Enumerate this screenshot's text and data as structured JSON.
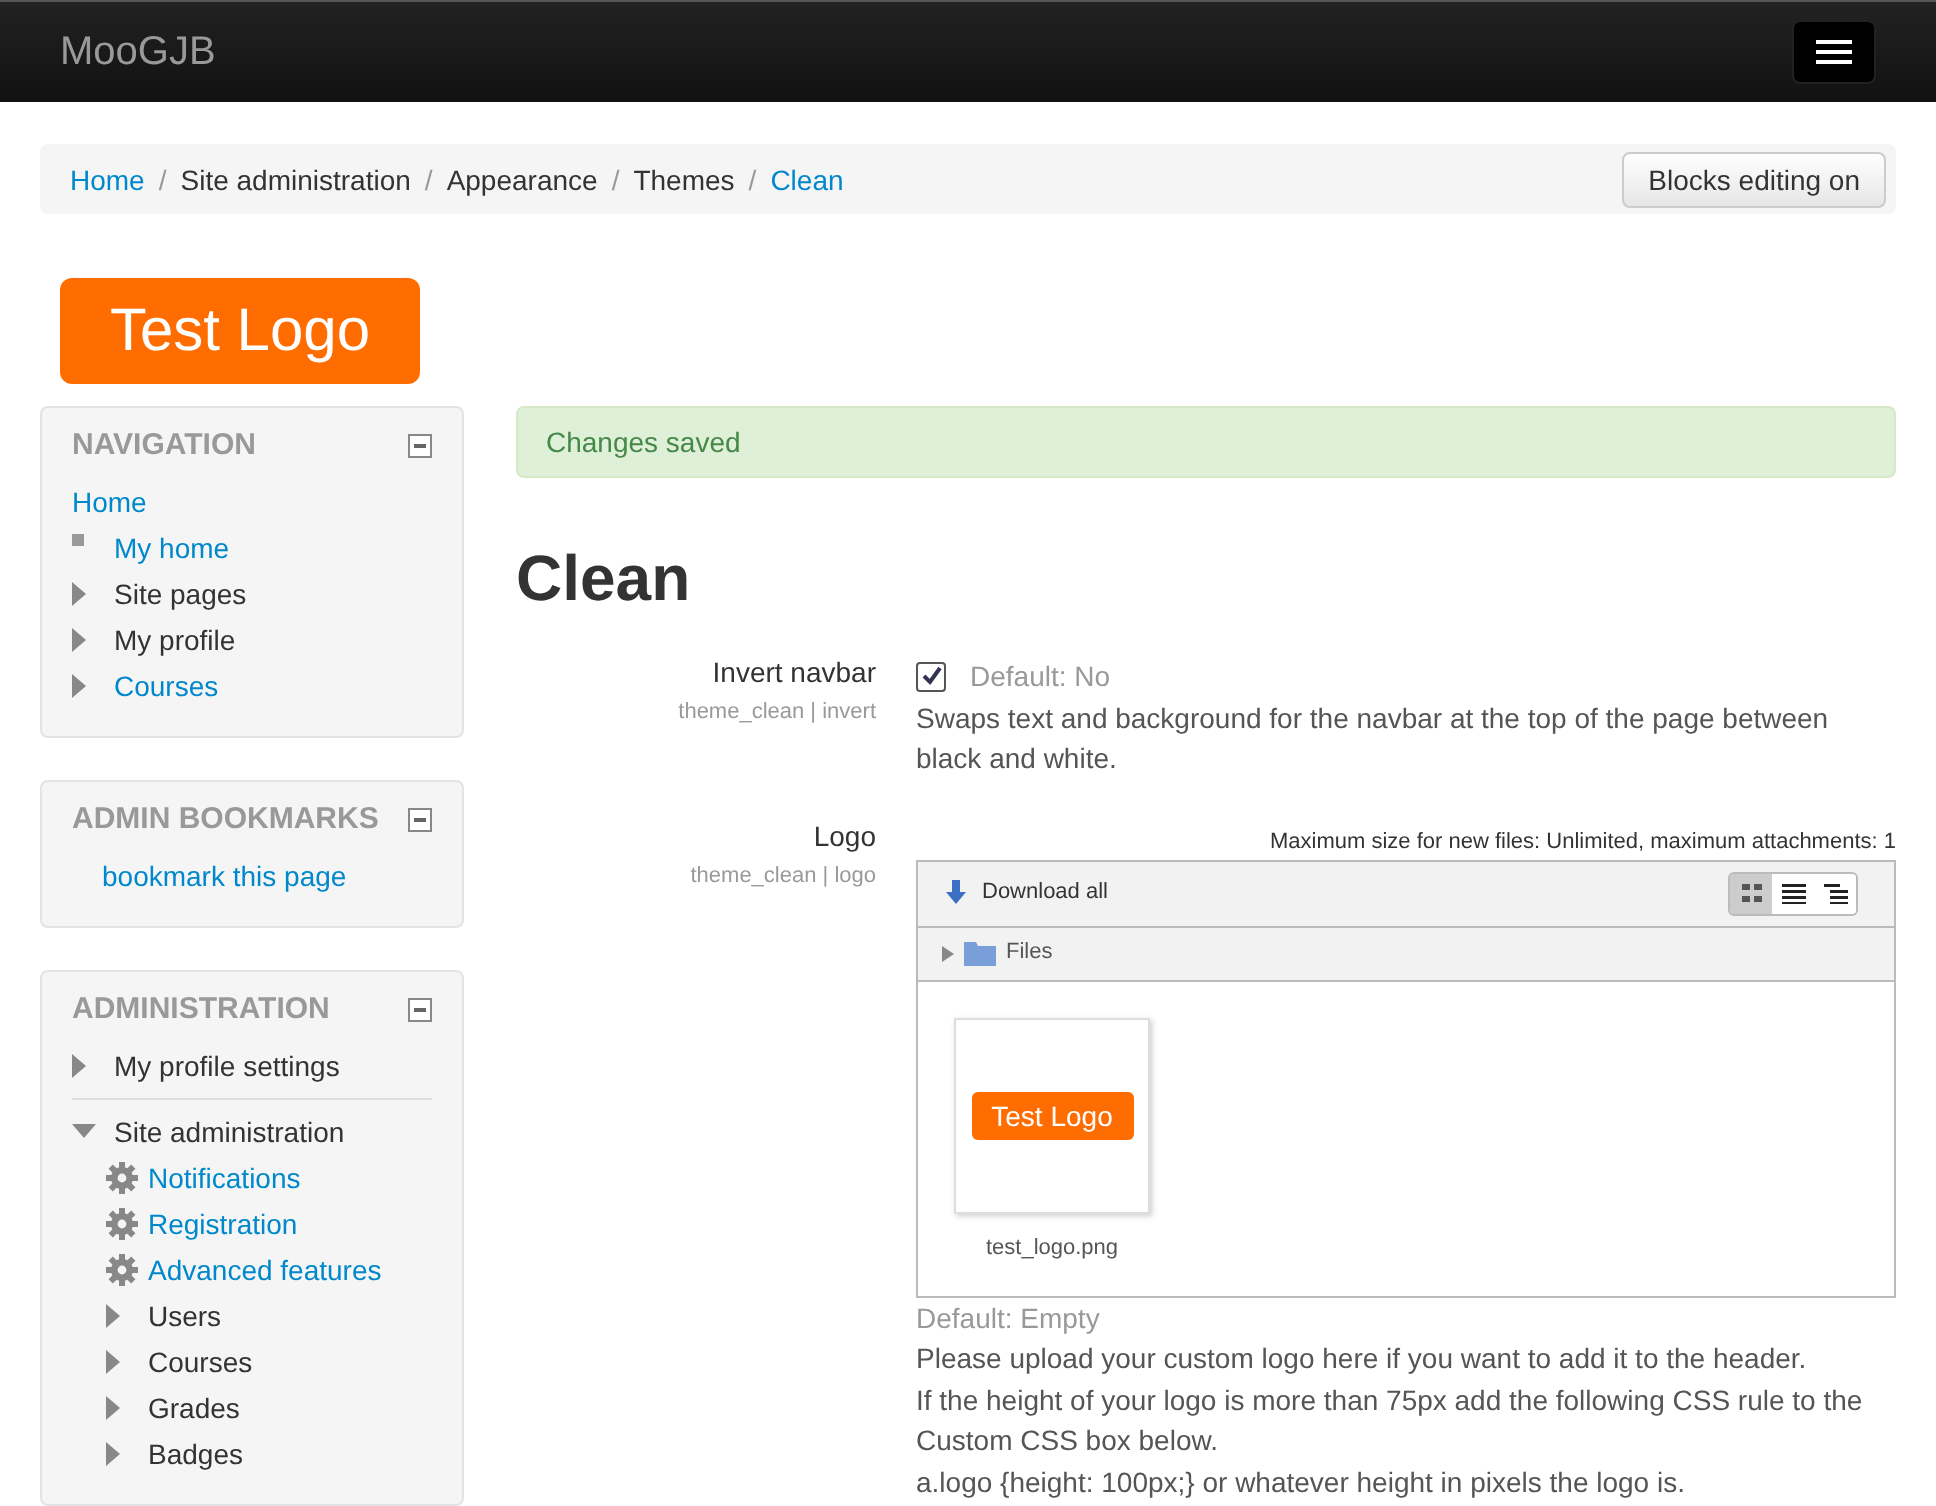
{
  "navbar": {
    "brand": "MooGJB"
  },
  "breadcrumb": [
    {
      "label": "Home",
      "link": true
    },
    {
      "separator": "/",
      "label": "Site administration",
      "link": false
    },
    {
      "separator": "/",
      "label": "Appearance",
      "link": false
    },
    {
      "separator": "/",
      "label": "Themes",
      "link": false
    },
    {
      "separator": "/",
      "label": "Clean",
      "link": true
    }
  ],
  "edit_button": "Blocks editing on",
  "logo": "Test Logo",
  "blocks": [
    {
      "title": "NAVIGATION",
      "items": [
        {
          "label": "Home",
          "link": true,
          "kind": "plain"
        },
        {
          "label": "My home",
          "link": true,
          "kind": "bullet"
        },
        {
          "label": "Site pages",
          "link": false,
          "kind": "arrow",
          "expanded": false
        },
        {
          "label": "My profile",
          "link": false,
          "kind": "arrow",
          "expanded": false
        },
        {
          "label": "Courses",
          "link": true,
          "kind": "arrow",
          "expanded": false
        }
      ]
    },
    {
      "title": "ADMIN BOOKMARKS",
      "items": [
        {
          "label": "bookmark this page",
          "link": true,
          "kind": "indent"
        }
      ]
    },
    {
      "title": "ADMINISTRATION",
      "items": [
        {
          "label": "My profile settings",
          "link": false,
          "kind": "arrow",
          "expanded": false
        },
        {
          "label": "Site administration",
          "link": false,
          "kind": "arrow",
          "expanded": true,
          "children": [
            {
              "label": "Notifications",
              "link": true,
              "kind": "gear"
            },
            {
              "label": "Registration",
              "link": true,
              "kind": "gear"
            },
            {
              "label": "Advanced features",
              "link": true,
              "kind": "gear"
            },
            {
              "label": "Users",
              "link": false,
              "kind": "arrow",
              "expanded": false
            },
            {
              "label": "Courses",
              "link": false,
              "kind": "arrow",
              "expanded": false
            },
            {
              "label": "Grades",
              "link": false,
              "kind": "arrow",
              "expanded": false
            },
            {
              "label": "Badges",
              "link": false,
              "kind": "arrow",
              "expanded": false
            }
          ]
        }
      ]
    }
  ],
  "alert": "Changes saved",
  "heading": "Clean",
  "settings": [
    {
      "kind": "checkbox",
      "label": "Invert navbar",
      "key": "theme_clean | invert",
      "checked": true,
      "default": "Default: No",
      "description": [
        "Swaps text and background for the navbar at the top of the page between black and white."
      ]
    },
    {
      "kind": "filemanager",
      "label": "Logo",
      "key": "theme_clean | logo",
      "limits": "Maximum size for new files: Unlimited, maximum attachments: 1",
      "download": "Download all",
      "folder": "Files",
      "files": [
        {
          "name": "test_logo.png",
          "preview": "Test Logo"
        }
      ],
      "default": "Default: Empty",
      "description": [
        "Please upload your custom logo here if you want to add it to the header.",
        "If the height of your logo is more than 75px add the following CSS rule to the Custom CSS box below.",
        "a.logo {height: 100px;} or whatever height in pixels the logo is."
      ]
    }
  ]
}
